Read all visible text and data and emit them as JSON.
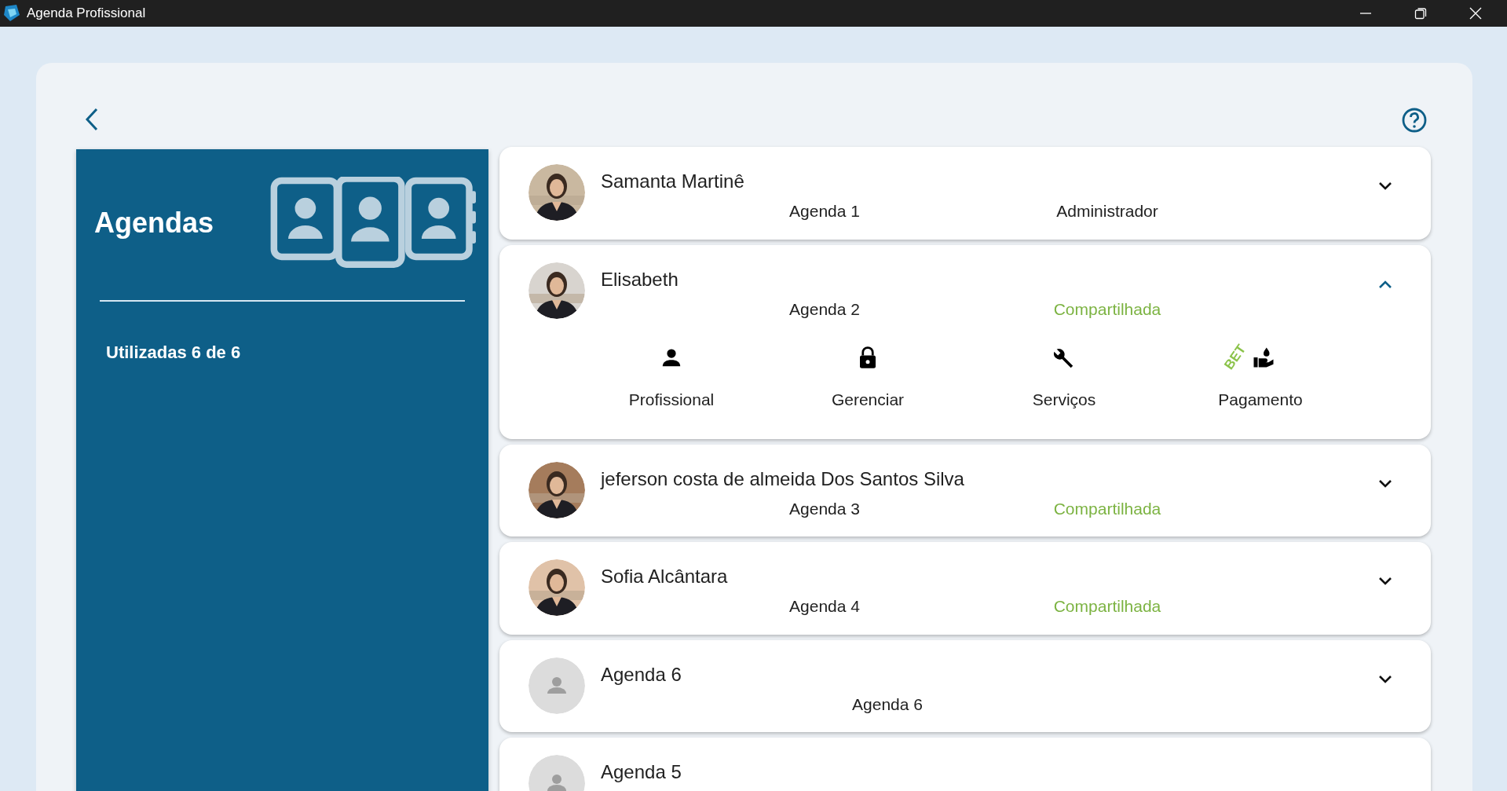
{
  "window": {
    "title": "Agenda Profissional"
  },
  "sidebar": {
    "title": "Agendas",
    "usage": "Utilizadas 6 de 6"
  },
  "agendas": [
    {
      "name": "Samanta Martinê",
      "agenda": "Agenda 1",
      "role": {
        "text": "Administrador",
        "color": "#212121"
      },
      "expanded": false
    },
    {
      "name": "Elisabeth",
      "agenda": "Agenda 2",
      "role": {
        "text": "Compartilhada",
        "color": "#7cb342"
      },
      "expanded": true,
      "actions": [
        {
          "label": "Profissional",
          "kind": "person"
        },
        {
          "label": "Gerenciar",
          "kind": "lock"
        },
        {
          "label": "Serviços",
          "kind": "wrench"
        },
        {
          "label": "Pagamento",
          "kind": "payment",
          "badge": "BET"
        }
      ]
    },
    {
      "name": "jeferson costa de almeida Dos Santos Silva",
      "agenda": "Agenda 3",
      "role": {
        "text": "Compartilhada",
        "color": "#7cb342"
      },
      "expanded": false
    },
    {
      "name": "Sofia Alcântara",
      "agenda": "Agenda 4",
      "role": {
        "text": "Compartilhada",
        "color": "#7cb342"
      },
      "expanded": false
    },
    {
      "name": "Agenda 6",
      "kind": "placeholder",
      "agenda": "Agenda 6",
      "expanded": false
    },
    {
      "name": "Agenda 5",
      "kind": "placeholder"
    }
  ]
}
